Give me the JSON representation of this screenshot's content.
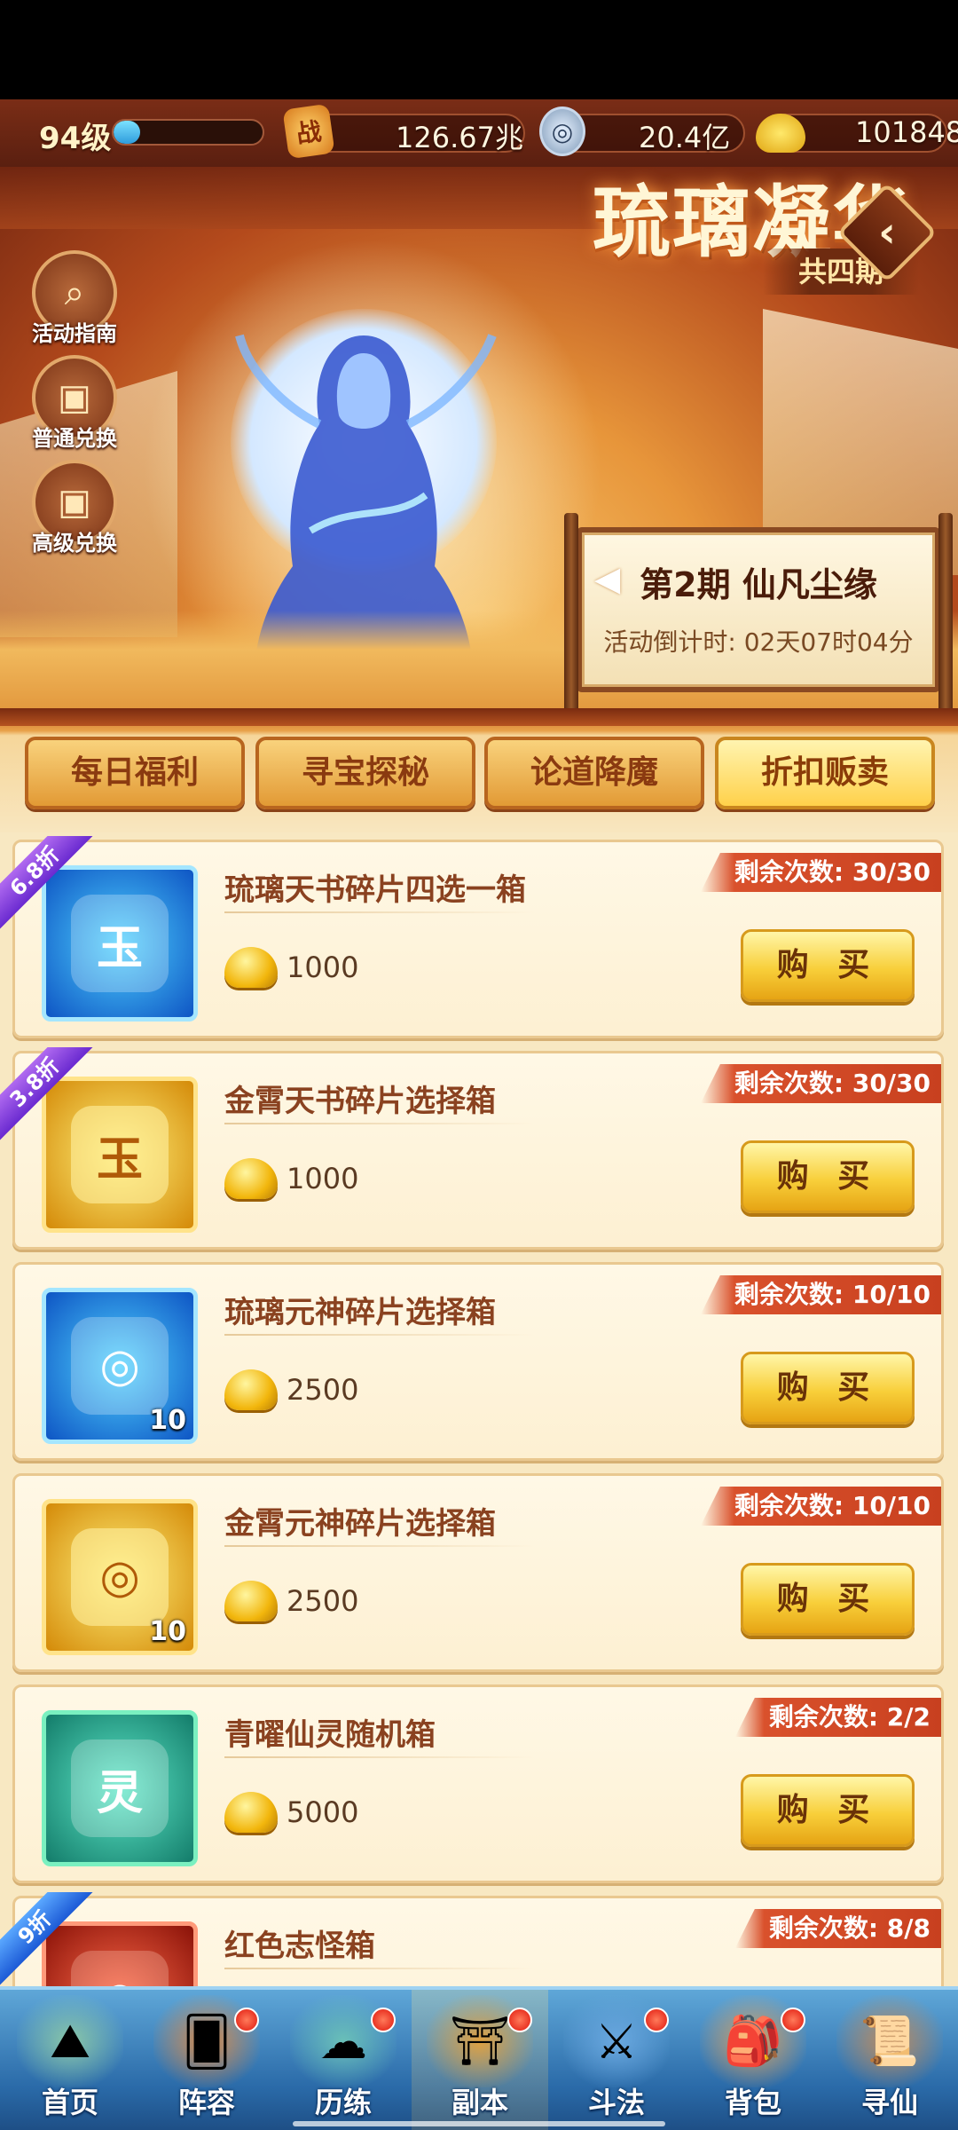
{
  "topbar": {
    "level": "94级",
    "xp_fraction": 0.18,
    "power_icon_text": "战",
    "power": "126.67兆",
    "coins": "20.4亿",
    "ingots": "101848"
  },
  "banner": {
    "title": "琉璃凝华",
    "subtitle": "共四期",
    "side_buttons": [
      {
        "label": "活动指南",
        "icon": "magnifier-icon"
      },
      {
        "label": "普通兑换",
        "icon": "gift-box-icon"
      },
      {
        "label": "高级兑换",
        "icon": "gift-box-icon"
      }
    ],
    "period": {
      "title": "第2期  仙凡尘缘",
      "countdown": "活动倒计时: 02天07时04分"
    }
  },
  "tabs": [
    {
      "label": "每日福利",
      "active": false
    },
    {
      "label": "寻宝探秘",
      "active": false
    },
    {
      "label": "论道降魔",
      "active": false
    },
    {
      "label": "折扣贩卖",
      "active": true
    }
  ],
  "buy_label": "购 买",
  "items": [
    {
      "name": "琉璃天书碎片四选一箱",
      "price": "1000",
      "remaining": "剩余次数: 30/30",
      "discount": "6.8折",
      "icon_char": "玉",
      "qty": ""
    },
    {
      "name": "金霄天书碎片选择箱",
      "price": "1000",
      "remaining": "剩余次数: 30/30",
      "discount": "3.8折",
      "icon_char": "玉",
      "qty": ""
    },
    {
      "name": "琉璃元神碎片选择箱",
      "price": "2500",
      "remaining": "剩余次数: 10/10",
      "discount": "",
      "icon_char": "◎",
      "qty": "10"
    },
    {
      "name": "金霄元神碎片选择箱",
      "price": "2500",
      "remaining": "剩余次数: 10/10",
      "discount": "",
      "icon_char": "◎",
      "qty": "10"
    },
    {
      "name": "青曜仙灵随机箱",
      "price": "5000",
      "remaining": "剩余次数: 2/2",
      "discount": "",
      "icon_char": "灵",
      "qty": ""
    },
    {
      "name": "红色志怪箱",
      "price": "",
      "remaining": "剩余次数: 8/8",
      "discount": "9折",
      "icon_char": "◉",
      "qty": ""
    }
  ],
  "nav": [
    {
      "label": "首页",
      "badge": false
    },
    {
      "label": "阵容",
      "badge": true
    },
    {
      "label": "历练",
      "badge": true
    },
    {
      "label": "副本",
      "badge": true
    },
    {
      "label": "斗法",
      "badge": true
    },
    {
      "label": "背包",
      "badge": true
    },
    {
      "label": "寻仙",
      "badge": false
    }
  ],
  "colors": {
    "accent_gold": "#f8cf3a",
    "remain_red": "#d9512c",
    "nav_blue": "#2a6aa8"
  }
}
